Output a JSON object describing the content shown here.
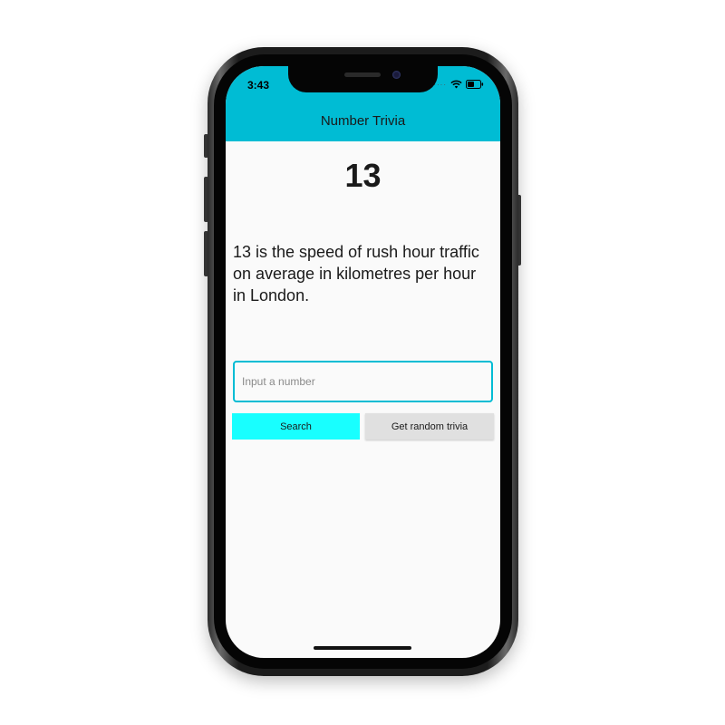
{
  "status_bar": {
    "time": "3:43",
    "signal": "····"
  },
  "app_bar": {
    "title": "Number Trivia",
    "color": "#00bcd4"
  },
  "trivia": {
    "number": "13",
    "text": "13 is the speed of rush hour traffic on average in kilometres per hour in London."
  },
  "input": {
    "placeholder": "Input a number",
    "value": "",
    "border_color": "#00bcd4"
  },
  "buttons": {
    "search_label": "Search",
    "search_color": "#18ffff",
    "random_label": "Get random trivia",
    "random_color": "#e0e0e0"
  },
  "icons": {
    "wifi": "wifi-icon",
    "battery": "battery-icon",
    "signal": "signal-icon"
  }
}
